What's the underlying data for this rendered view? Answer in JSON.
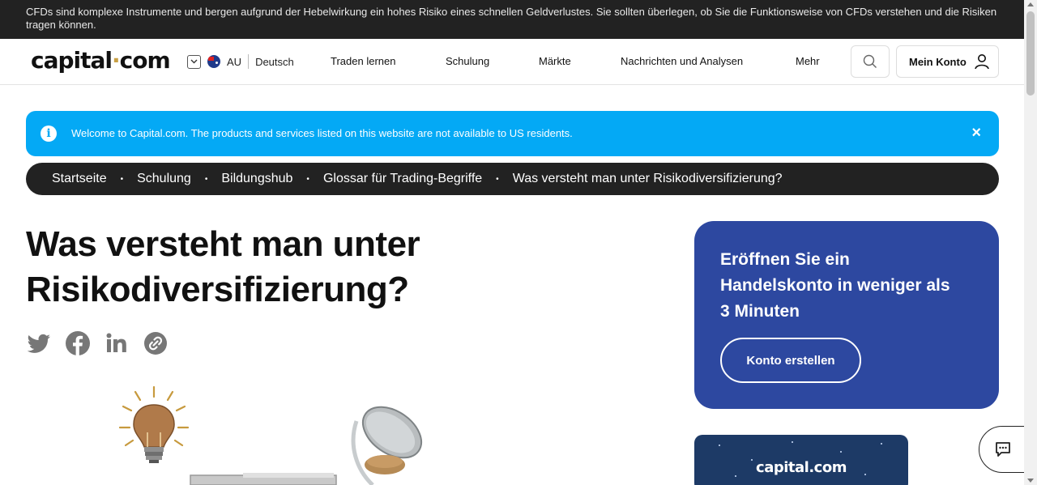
{
  "risk_warning": "CFDs sind komplexe Instrumente und bergen aufgrund der Hebelwirkung ein hohes Risiko eines schnellen Geldverlustes. Sie sollten überlegen, ob Sie die Funktionsweise von CFDs verstehen und die Risiken tragen können.",
  "header": {
    "logo_part1": "capital",
    "logo_dot": "·",
    "logo_part2": "com",
    "region_code": "AU",
    "language": "Deutsch",
    "nav": [
      "Traden lernen",
      "Schulung",
      "Märkte",
      "Nachrichten und Analysen",
      "Mehr"
    ],
    "account_label": "Mein Konto",
    "icons": {
      "search": "search-icon",
      "account": "user-icon",
      "region": "chevron-down-icon"
    }
  },
  "notice": {
    "text": "Welcome to Capital.com. The products and services listed on this website are not available to US residents.",
    "info_glyph": "i",
    "close_glyph": "×"
  },
  "breadcrumb": [
    "Startseite",
    "Schulung",
    "Bildungshub",
    "Glossar für Trading-Begriffe",
    "Was versteht man unter Risikodiversifizierung?"
  ],
  "breadcrumb_separator": "•",
  "page": {
    "title_line1": "Was versteht man unter",
    "title_line2": "Risikodiversifizierung?"
  },
  "social": [
    "twitter-icon",
    "facebook-icon",
    "linkedin-icon",
    "copy-link-icon"
  ],
  "promo": {
    "headline": "Eröffnen Sie ein Handelskonto in weniger als 3 Minuten",
    "button": "Konto erstellen"
  },
  "card2": {
    "logo": "capital.com"
  },
  "colors": {
    "accent_blue": "#04a9f5",
    "promo_blue": "#2d48a0",
    "dark": "#222222",
    "logo_dot": "#c9a045"
  }
}
